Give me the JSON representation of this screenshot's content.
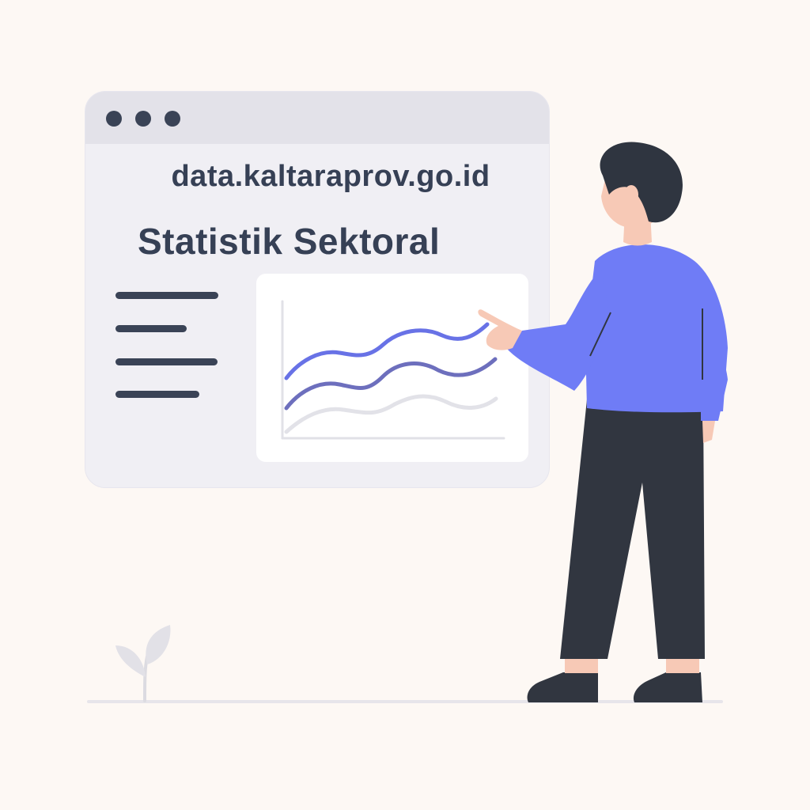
{
  "browser": {
    "url": "data.kaltaraprov.go.id",
    "heading": "Statistik Sektoral"
  },
  "colors": {
    "background": "#fdf8f4",
    "window": "#f0eff4",
    "titlebar": "#e3e2e9",
    "text": "#364055",
    "shirt": "#6f7cf6",
    "pants": "#313640",
    "skin": "#f7c9b6",
    "line_primary": "#6872e6",
    "line_secondary": "#6d6fbd",
    "line_tertiary": "#e2e2e8"
  },
  "icons": {
    "window_controls": [
      "window-dot-icon",
      "window-dot-icon",
      "window-dot-icon"
    ],
    "plant": "plant-icon",
    "person": "person-illustration"
  }
}
